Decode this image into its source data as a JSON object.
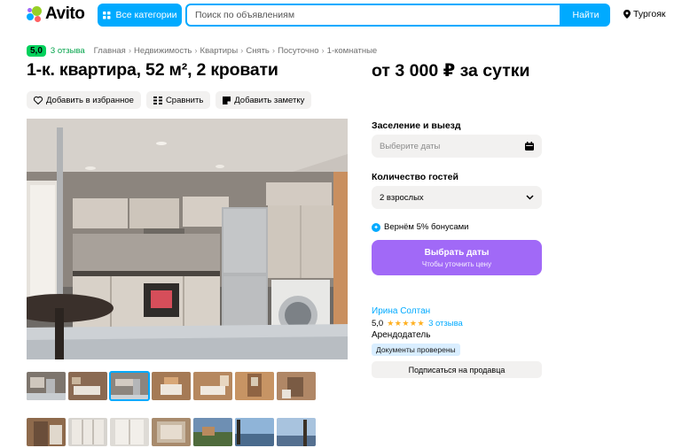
{
  "header": {
    "logo_text": "Avito",
    "categories_label": "Все категории",
    "search_placeholder": "Поиск по объявлениям",
    "search_button": "Найти",
    "location": "Тургояк"
  },
  "breadcrumb": {
    "rating": "5,0",
    "reviews": "3 отзыва",
    "items": [
      "Главная",
      "Недвижимость",
      "Квартиры",
      "Снять",
      "Посуточно",
      "1-комнатные"
    ]
  },
  "listing": {
    "title": "1-к. квартира, 52 м², 2 кровати",
    "price": "от 3 000 ₽ за сутки",
    "actions": {
      "favorite": "Добавить в избранное",
      "compare": "Сравнить",
      "note": "Добавить заметку"
    }
  },
  "booking": {
    "checkin_label": "Заселение и выезд",
    "dates_placeholder": "Выберите даты",
    "guests_label": "Количество гостей",
    "guests_value": "2 взрослых",
    "bonus_text": "Вернём 5% бонусами",
    "cta_main": "Выбрать даты",
    "cta_sub": "Чтобы уточнить цену"
  },
  "seller": {
    "name": "Ирина Солтан",
    "rating": "5,0",
    "stars": "★★★★★",
    "reviews": "3 отзыва",
    "role": "Арендодатель",
    "docs_badge": "Документы проверены",
    "subscribe": "Подписаться на продавца"
  },
  "colors": {
    "brand_blue": "#00aaff",
    "cta_purple": "#a169f7",
    "rating_green": "#02d15c"
  }
}
